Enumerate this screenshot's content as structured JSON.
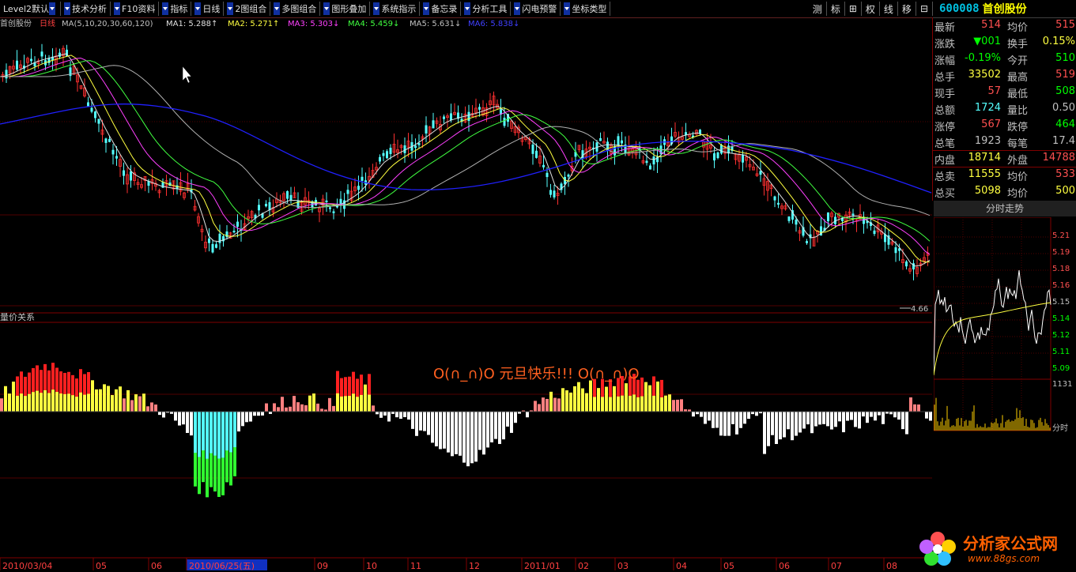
{
  "toolbar": {
    "items": [
      "Level2默认",
      "技术分析",
      "F10资料",
      "指标",
      "日线",
      "2图组合",
      "多图组合",
      "图形叠加",
      "系统指示",
      "备忘录",
      "分析工具",
      "闪电预警",
      "坐标类型"
    ],
    "right_items": [
      "测",
      "标",
      "⊞",
      "权",
      "线",
      "移",
      "⊟"
    ]
  },
  "header": {
    "code": "600008",
    "name": "首创股份"
  },
  "chart": {
    "stock_label": "首创股份",
    "period_label": "日线",
    "ma_params": "MA(5,10,20,30,60,120)",
    "ma1": "MA1: 5.288↑",
    "ma2": "MA2: 5.271↑",
    "ma3": "MA3: 5.303↓",
    "ma4": "MA4: 5.459↓",
    "ma5": "MA5: 5.631↓",
    "ma6": "MA6: 5.838↓",
    "low_marker": "4.66",
    "volume_title": "量价关系",
    "greeting": "O(∩_∩)O  元旦快乐!!! O(∩_∩)O",
    "dates": [
      "2010/03/04",
      "05",
      "06",
      "2010/06/25(五)",
      "09",
      "10",
      "11",
      "12",
      "2011/01",
      "02",
      "03",
      "04",
      "05",
      "06",
      "07",
      "08"
    ],
    "colors": {
      "up": "#ff3030",
      "down": "#54ffff",
      "ma_white": "#e0e0e0",
      "ma_yellow": "#ffff40",
      "ma_magenta": "#ff40ff",
      "ma_green": "#40ff40",
      "ma_grey": "#b0b0b0",
      "ma_blue": "#2020ff"
    }
  },
  "quote": {
    "rows": [
      {
        "l1": "最新",
        "v1": "514",
        "l2": "均价",
        "v2": "515"
      },
      {
        "l1": "涨跌",
        "v1": "▼001",
        "l2": "换手",
        "v2": "0.15%"
      },
      {
        "l1": "涨幅",
        "v1": "-0.19%",
        "l2": "今开",
        "v2": "510"
      },
      {
        "l1": "总手",
        "v1": "33502",
        "l2": "最高",
        "v2": "519"
      },
      {
        "l1": "现手",
        "v1": "57",
        "l2": "最低",
        "v2": "508"
      },
      {
        "l1": "总额",
        "v1": "1724",
        "l2": "量比",
        "v2": "0.50"
      },
      {
        "l1": "涨停",
        "v1": "567",
        "l2": "跌停",
        "v2": "464"
      },
      {
        "l1": "总笔",
        "v1": "1923",
        "l2": "每笔",
        "v2": "17.4"
      },
      {
        "l1": "内盘",
        "v1": "18714",
        "l2": "外盘",
        "v2": "14788"
      },
      {
        "l1": "总卖",
        "v1": "11555",
        "l2": "均价",
        "v2": "533"
      },
      {
        "l1": "总买",
        "v1": "5098",
        "l2": "均价",
        "v2": "500"
      }
    ]
  },
  "intraday": {
    "title": "分时走势",
    "price_ticks": [
      "5.21",
      "5.19",
      "5.18",
      "5.16",
      "5.15",
      "5.14",
      "5.12",
      "5.11",
      "5.09"
    ],
    "volume_max": "1131",
    "time_label": "分时"
  },
  "logo": {
    "text": "分析家公式网",
    "url": "www.88gs.com"
  }
}
